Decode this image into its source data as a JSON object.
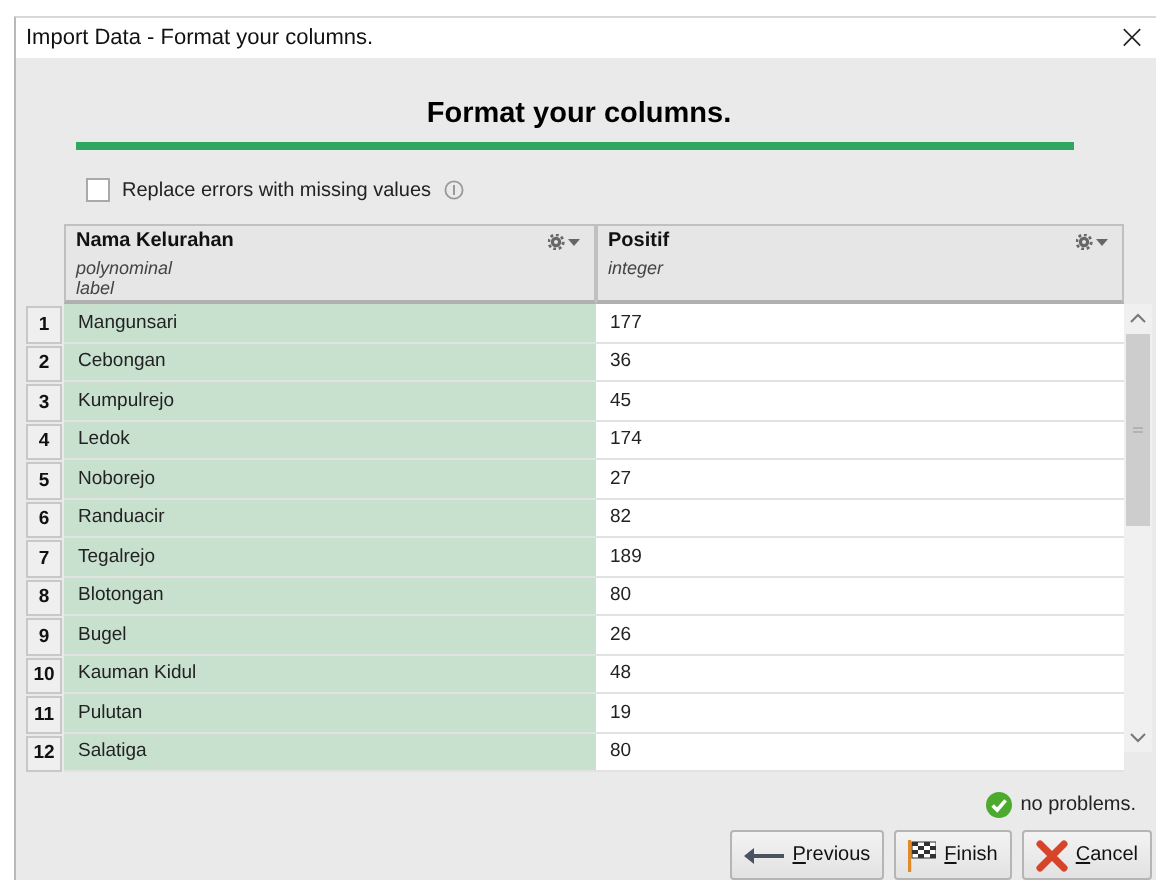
{
  "window": {
    "title": "Import Data - Format your columns.",
    "close": "×"
  },
  "heading": "Format your columns.",
  "progress": {
    "level": 1
  },
  "replace_errors": {
    "label": "Replace errors with missing values",
    "checked": false
  },
  "table": {
    "columns": [
      {
        "name": "Nama Kelurahan",
        "type": "polynominal",
        "role": "label",
        "selected": true
      },
      {
        "name": "Positif",
        "type": "integer",
        "selected": false
      }
    ],
    "rows": [
      {
        "index": "1",
        "cells": [
          "Mangunsari",
          "177"
        ]
      },
      {
        "index": "2",
        "cells": [
          "Cebongan",
          "36"
        ]
      },
      {
        "index": "3",
        "cells": [
          "Kumpulrejo",
          "45"
        ]
      },
      {
        "index": "4",
        "cells": [
          "Ledok",
          "174"
        ]
      },
      {
        "index": "5",
        "cells": [
          "Noborejo",
          "27"
        ]
      },
      {
        "index": "6",
        "cells": [
          "Randuacir",
          "82"
        ]
      },
      {
        "index": "7",
        "cells": [
          "Tegalrejo",
          "189"
        ]
      },
      {
        "index": "8",
        "cells": [
          "Blotongan",
          "80"
        ]
      },
      {
        "index": "9",
        "cells": [
          "Bugel",
          "26"
        ]
      },
      {
        "index": "10",
        "cells": [
          "Kauman Kidul",
          "48"
        ]
      },
      {
        "index": "11",
        "cells": [
          "Pulutan",
          "19"
        ]
      },
      {
        "index": "12",
        "cells": [
          "Salatiga",
          "80"
        ]
      }
    ]
  },
  "status": "no problems.",
  "buttons": [
    {
      "kind": "previous",
      "label": "Previous"
    },
    {
      "kind": "finish",
      "label": "Finish"
    },
    {
      "kind": "cancel",
      "label": "Cancel"
    }
  ]
}
